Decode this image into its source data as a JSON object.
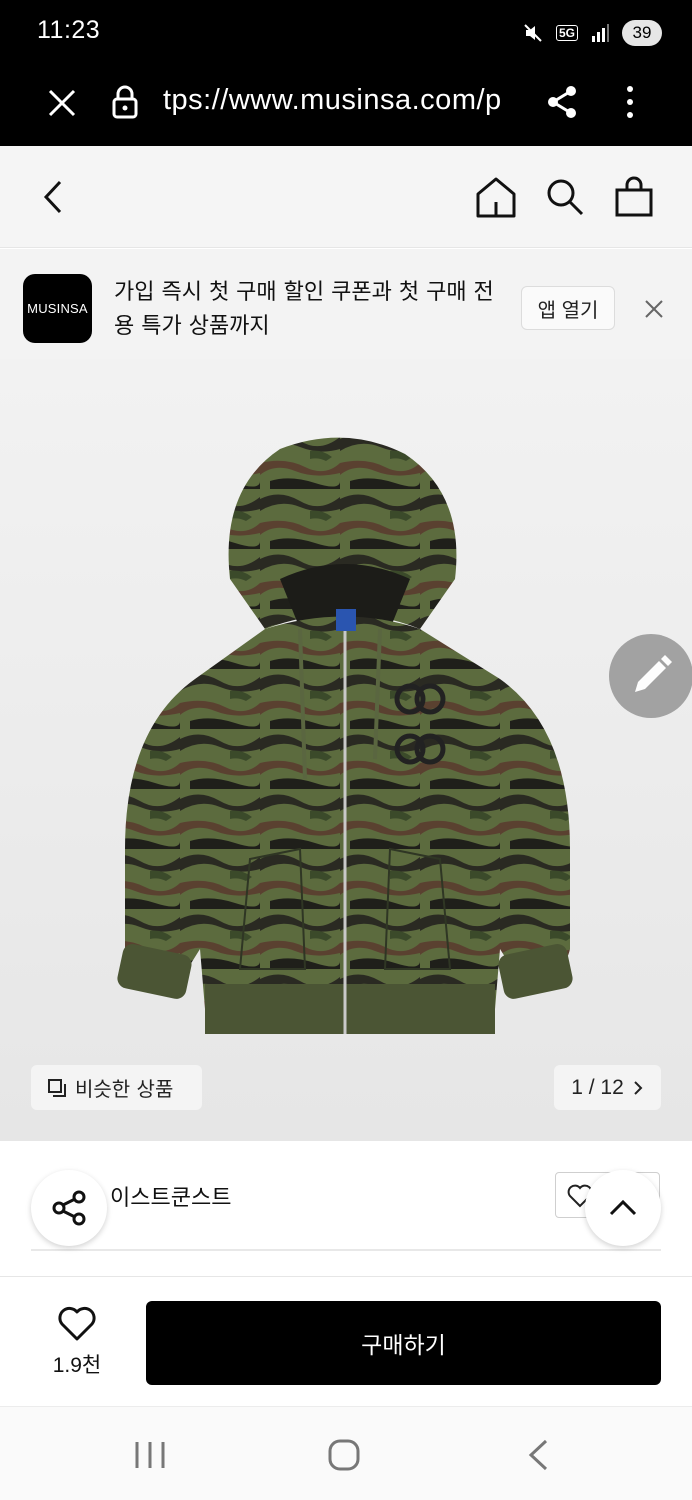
{
  "status_bar": {
    "time": "11:23",
    "network": "5G",
    "battery": "39"
  },
  "browser": {
    "url": "tps://www.musinsa.com/p"
  },
  "banner": {
    "logo_text": "MUSINSA",
    "message": "가입 즉시 첫 구매 할인 쿠폰과 첫 구매 전용 특가 상품까지",
    "open_app_label": "앱 열기"
  },
  "product": {
    "similar_label": "비슷한 상품",
    "image_counter": "1 / 12",
    "brand": "이스트쿤스트"
  },
  "purchase": {
    "like_count": "1.9천",
    "buy_label": "구매하기"
  },
  "colors": {
    "buy_button": "#000000",
    "status_bar": "#000000"
  },
  "icons": [
    "close-icon",
    "lock-icon",
    "share-icon",
    "more-icon",
    "back-icon",
    "home-icon",
    "search-icon",
    "cart-icon",
    "edit-icon",
    "similar-icon",
    "chevron-right-icon",
    "heart-icon",
    "chevron-up-icon",
    "recent-apps-icon",
    "home-nav-icon",
    "back-nav-icon"
  ]
}
